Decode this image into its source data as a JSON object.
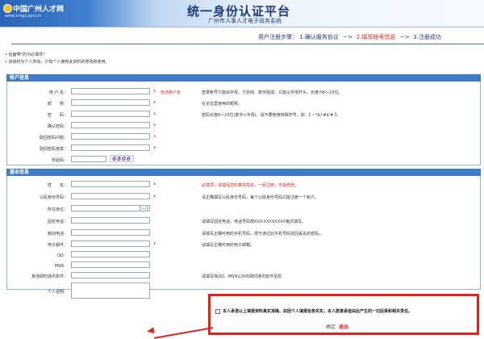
{
  "header": {
    "logo_text": "中国广州人才网",
    "logo_url": "www.hrsgz.gov.cn",
    "title": "统一身份认证平台",
    "subtitle": "广州市人事人才电子政务系统"
  },
  "steps": {
    "prefix": "用户注册步骤：",
    "step1": "1.确认服务协议",
    "arrow": "－>",
    "step2": "2.填写帐号信息",
    "step3": "3.注册成功"
  },
  "notes": {
    "n1_pre": "• 后面带",
    "n1_star": "*",
    "n1_post": "的为必填项！",
    "n2": "• 该资料为个人所有，只有个人拥有此资料的修改和使用。"
  },
  "account": {
    "section_title": "帐户信息",
    "username_label": "用 户 名：",
    "username_check": "检测用户名",
    "username_hint": "登录帐号只能由字母、下划线、数字组成，只能以字母开头，长度为6～20位。",
    "nickname_label": "昵　　称：",
    "nickname_hint": "在论坛里使用的昵称。",
    "password_label": "密　　码：",
    "password_hint": "密码长度6～20位(数字+字母)，请不要使用特殊符号，如：【 ~*&/'#$'# 】。",
    "confirm_label": "确认密码：",
    "question_label": "取回密码问题：",
    "answer_label": "取回密码答案：",
    "captcha_label": "校验码：",
    "captcha_text": "6806"
  },
  "basic": {
    "section_title": "基本信息",
    "name_label": "姓　　名：",
    "name_hint": "必填项，请填写您的真实姓名，一经注册，不能修改。",
    "id_label": "公民身份号码：",
    "id_hint": "请正确填写公民身份号码，每个公民身份号码只能注册一个帐户。",
    "unit_label": "所在单位：",
    "unit_pick": "...",
    "phone_label": "固定电话：",
    "phone_hint": "请填写固定电话，电话号码按XXX-XXXXXXXX格式填写。",
    "mobile_label": "移动电话：",
    "mobile_hint": "请填写正确可用的手机号码，便于通过此手机号码找回丢失的密码。。",
    "email_label": "电子邮件：",
    "email_hint": "请填写正确可用的电子邮箱。",
    "qq_label": "QQ：",
    "msn_label": "MSN：",
    "im_label": "其他即时通讯软件：",
    "im_hint": "请填写除QQ、MSN以外的即时通讯软件信息",
    "bio_label": "个人说明："
  },
  "agreement": {
    "text": "本人承诺以上填报资料真实准确，如因个人填报信息失实，本人愿意承担由此产生的一切后果和相关责任。",
    "confirm": "确定",
    "exit": "退出"
  },
  "colors": {
    "accent": "#3f7bc8",
    "required": "#e0191b",
    "highlight": "#e2231a"
  }
}
